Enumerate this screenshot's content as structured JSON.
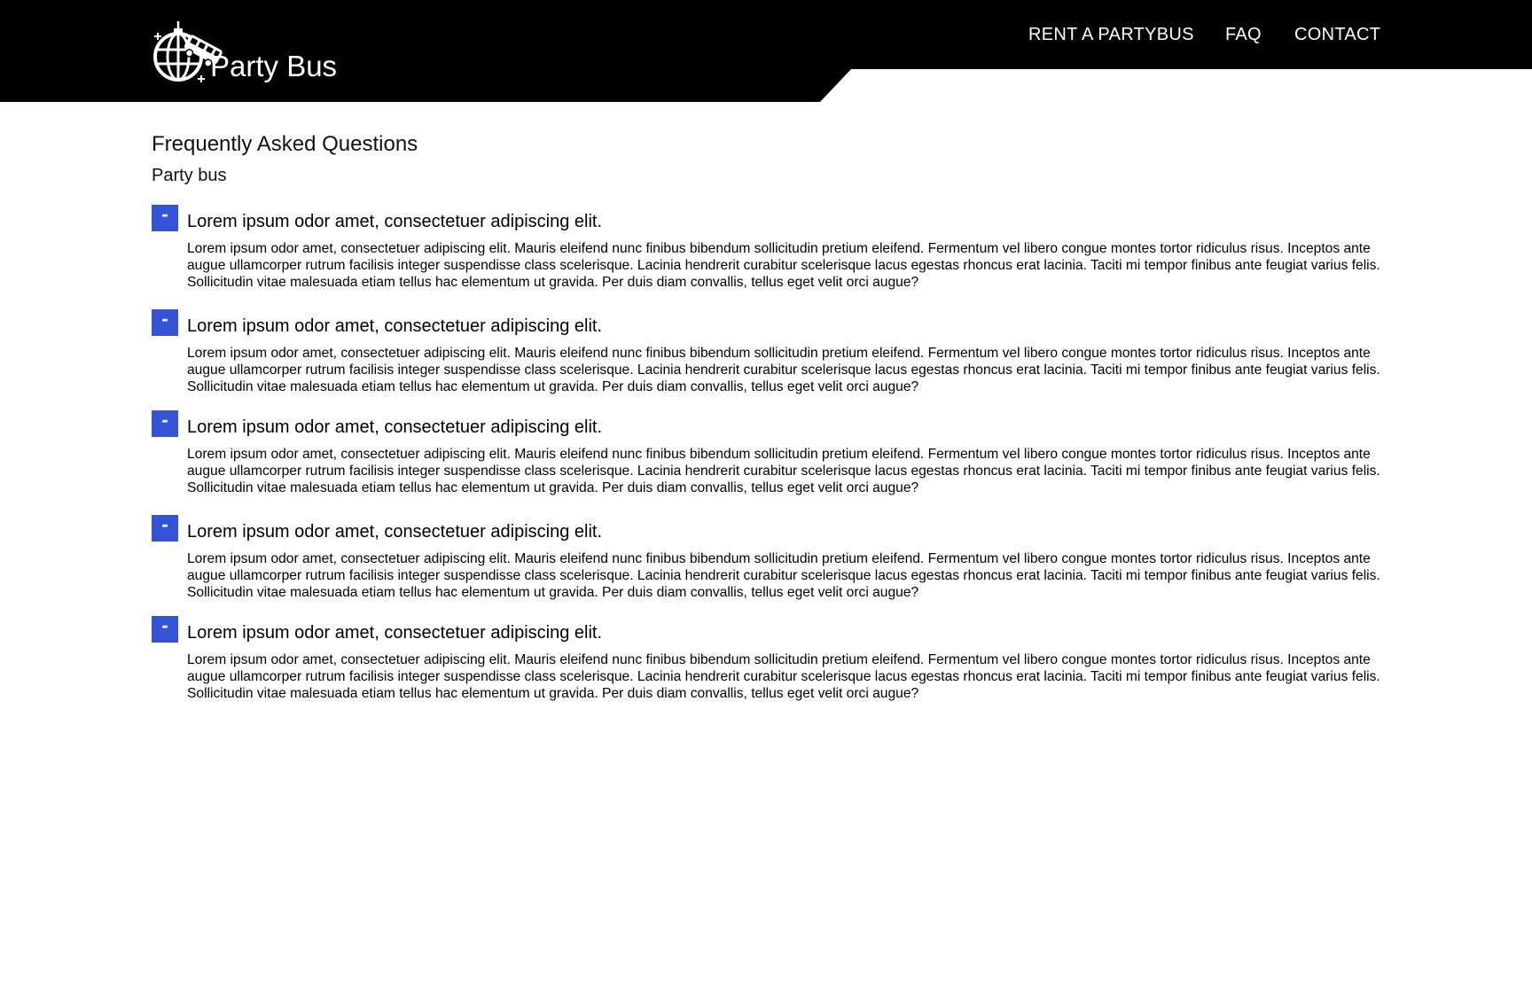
{
  "header": {
    "logo_text": "Party Bus",
    "background_color": "#000000",
    "nav": [
      {
        "label": "RENT A PARTYBUS"
      },
      {
        "label": "FAQ"
      },
      {
        "label": "CONTACT"
      }
    ],
    "icons": [
      "disco-ball-icon",
      "bus-icon",
      "sparkle-icon"
    ]
  },
  "main": {
    "title": "Frequently Asked Questions",
    "subtitle": "Party bus",
    "accent_color": "#3553d6",
    "toggle_symbol": "-",
    "faqs": [
      {
        "question": "Lorem ipsum odor amet, consectetuer adipiscing elit.",
        "answer": "Lorem ipsum odor amet, consectetuer adipiscing elit. Mauris eleifend nunc finibus bibendum sollicitudin pretium eleifend. Fermentum vel libero congue montes tortor ridiculus risus. Inceptos ante augue ullamcorper rutrum facilisis integer suspendisse class scelerisque. Lacinia hendrerit curabitur scelerisque lacus egestas rhoncus erat lacinia. Taciti mi tempor finibus ante feugiat varius felis. Sollicitudin vitae malesuada etiam tellus hac elementum ut gravida. Per duis diam convallis, tellus eget velit orci augue?"
      },
      {
        "question": "Lorem ipsum odor amet, consectetuer adipiscing elit.",
        "answer": "Lorem ipsum odor amet, consectetuer adipiscing elit. Mauris eleifend nunc finibus bibendum sollicitudin pretium eleifend. Fermentum vel libero congue montes tortor ridiculus risus. Inceptos ante augue ullamcorper rutrum facilisis integer suspendisse class scelerisque. Lacinia hendrerit curabitur scelerisque lacus egestas rhoncus erat lacinia. Taciti mi tempor finibus ante feugiat varius felis. Sollicitudin vitae malesuada etiam tellus hac elementum ut gravida. Per duis diam convallis, tellus eget velit orci augue?"
      },
      {
        "question": "Lorem ipsum odor amet, consectetuer adipiscing elit.",
        "answer": "Lorem ipsum odor amet, consectetuer adipiscing elit. Mauris eleifend nunc finibus bibendum sollicitudin pretium eleifend. Fermentum vel libero congue montes tortor ridiculus risus. Inceptos ante augue ullamcorper rutrum facilisis integer suspendisse class scelerisque. Lacinia hendrerit curabitur scelerisque lacus egestas rhoncus erat lacinia. Taciti mi tempor finibus ante feugiat varius felis. Sollicitudin vitae malesuada etiam tellus hac elementum ut gravida. Per duis diam convallis, tellus eget velit orci augue?"
      },
      {
        "question": "Lorem ipsum odor amet, consectetuer adipiscing elit.",
        "answer": "Lorem ipsum odor amet, consectetuer adipiscing elit. Mauris eleifend nunc finibus bibendum sollicitudin pretium eleifend. Fermentum vel libero congue montes tortor ridiculus risus. Inceptos ante augue ullamcorper rutrum facilisis integer suspendisse class scelerisque. Lacinia hendrerit curabitur scelerisque lacus egestas rhoncus erat lacinia. Taciti mi tempor finibus ante feugiat varius felis. Sollicitudin vitae malesuada etiam tellus hac elementum ut gravida. Per duis diam convallis, tellus eget velit orci augue?"
      },
      {
        "question": "Lorem ipsum odor amet, consectetuer adipiscing elit.",
        "answer": "Lorem ipsum odor amet, consectetuer adipiscing elit. Mauris eleifend nunc finibus bibendum sollicitudin pretium eleifend. Fermentum vel libero congue montes tortor ridiculus risus. Inceptos ante augue ullamcorper rutrum facilisis integer suspendisse class scelerisque. Lacinia hendrerit curabitur scelerisque lacus egestas rhoncus erat lacinia. Taciti mi tempor finibus ante feugiat varius felis. Sollicitudin vitae malesuada etiam tellus hac elementum ut gravida. Per duis diam convallis, tellus eget velit orci augue?"
      }
    ]
  }
}
